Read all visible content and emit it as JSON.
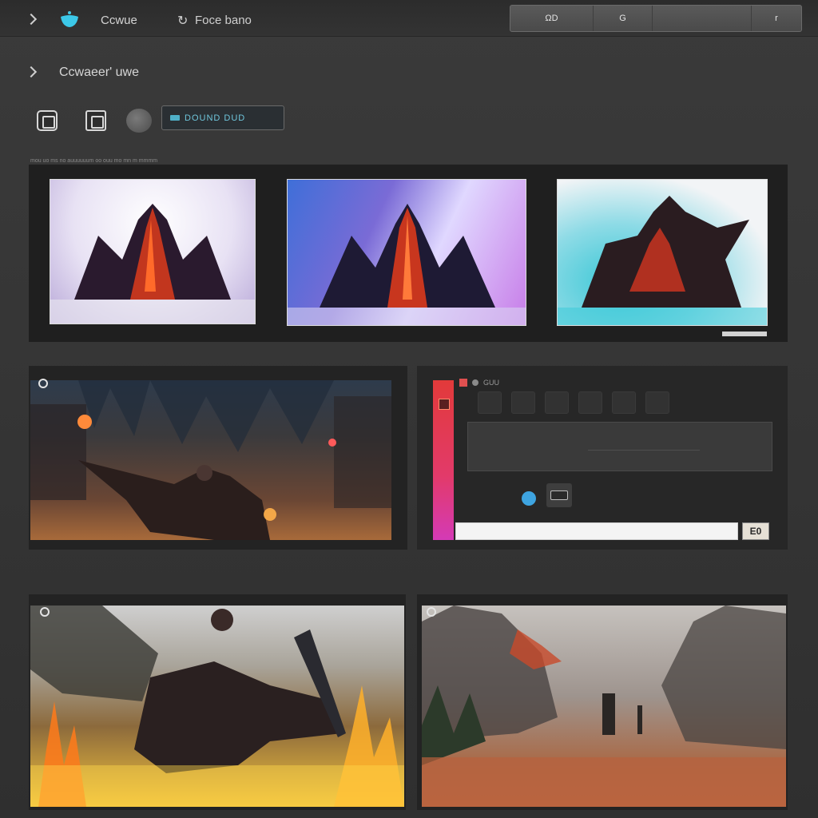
{
  "header": {
    "title": "Ccwue",
    "subtitle": "Foce bano",
    "segmented": [
      {
        "label": "ΩD",
        "width": 104
      },
      {
        "label": "G",
        "width": 74
      },
      {
        "label": "",
        "width": 124
      },
      {
        "label": "r",
        "width": 62
      }
    ]
  },
  "section": {
    "title": "Ccwaeer' uwe"
  },
  "toolbar": {
    "filter_chip_text": "DOUND DUD"
  },
  "gallery": {
    "caption": "mou uo ms no auuuuuum oo ouu mo mn m mmmm"
  },
  "editor": {
    "mini_label": "GUU",
    "go_label": "E0",
    "input_value": ""
  },
  "colors": {
    "accent_red": "#e23a3a",
    "accent_magenta": "#d43ab6",
    "accent_blue": "#3ea4e0",
    "chip_teal": "#6fc6dc"
  }
}
